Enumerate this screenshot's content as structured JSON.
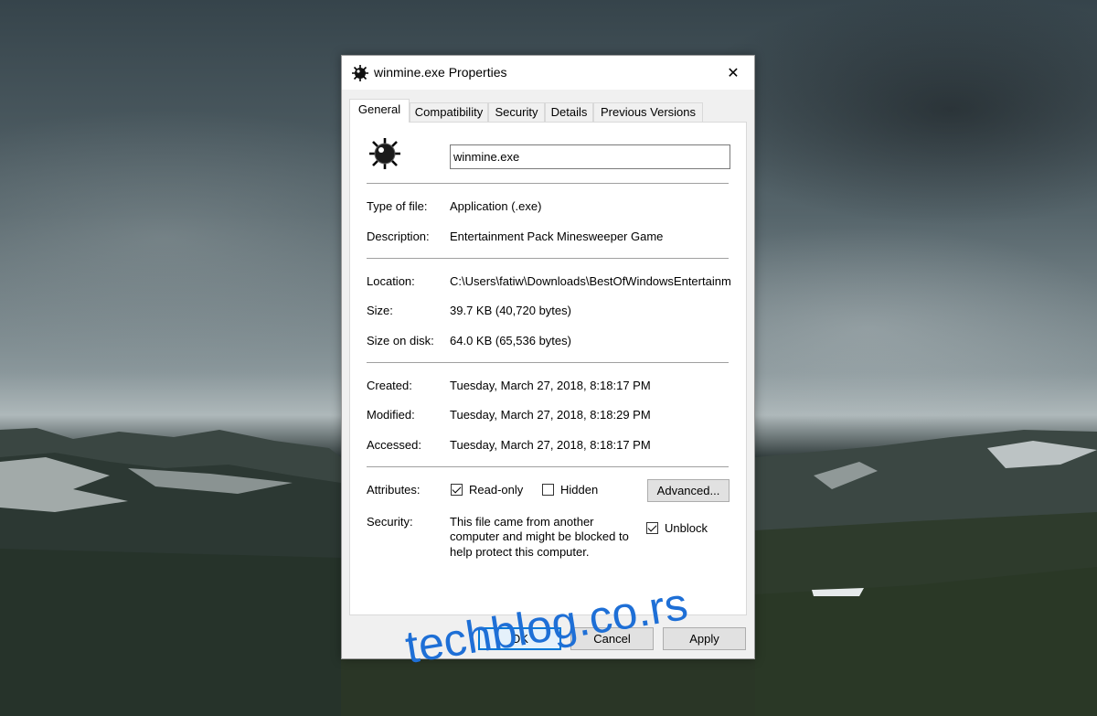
{
  "dialog": {
    "title": "winmine.exe Properties",
    "icon": "minesweeper-mine-icon",
    "close_label": "✕"
  },
  "tabs": [
    {
      "label": "General",
      "active": true
    },
    {
      "label": "Compatibility",
      "active": false
    },
    {
      "label": "Security",
      "active": false
    },
    {
      "label": "Details",
      "active": false
    },
    {
      "label": "Previous Versions",
      "active": false
    }
  ],
  "general": {
    "file_name": "winmine.exe",
    "type_of_file_label": "Type of file:",
    "type_of_file": "Application (.exe)",
    "description_label": "Description:",
    "description": "Entertainment Pack Minesweeper Game",
    "location_label": "Location:",
    "location": "C:\\Users\\fatiw\\Downloads\\BestOfWindowsEntertainmentPack",
    "size_label": "Size:",
    "size": "39.7 KB (40,720 bytes)",
    "size_on_disk_label": "Size on disk:",
    "size_on_disk": "64.0 KB (65,536 bytes)",
    "created_label": "Created:",
    "created": "Tuesday, March 27, 2018, 8:18:17 PM",
    "modified_label": "Modified:",
    "modified": "Tuesday, March 27, 2018, 8:18:29 PM",
    "accessed_label": "Accessed:",
    "accessed": "Tuesday, March 27, 2018, 8:18:17 PM",
    "attributes_label": "Attributes:",
    "readonly_label": "Read-only",
    "readonly_checked": true,
    "hidden_label": "Hidden",
    "hidden_checked": false,
    "advanced_label": "Advanced...",
    "security_label": "Security:",
    "security_line1": "This file came from another",
    "security_line2": "computer and might be blocked to",
    "security_line3": "help protect this computer.",
    "unblock_label": "Unblock",
    "unblock_checked": true
  },
  "footer": {
    "ok_label": "OK",
    "cancel_label": "Cancel",
    "apply_label": "Apply"
  },
  "watermark": "techblog.co.rs",
  "colors": {
    "accent": "#0078d7",
    "watermark": "#1e6fd6"
  }
}
